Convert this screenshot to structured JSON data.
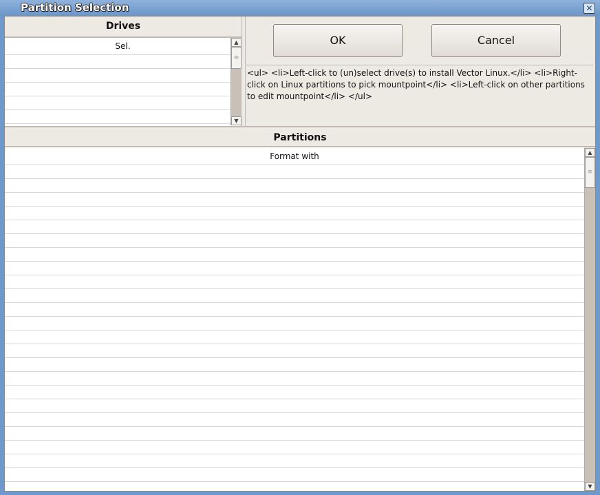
{
  "window": {
    "title": "Partition Selection",
    "close_icon": "close-icon"
  },
  "drives": {
    "header": "Drives",
    "columns": [
      "Sel."
    ],
    "rows": []
  },
  "buttons": {
    "ok": "OK",
    "cancel": "Cancel"
  },
  "info_text": "<ul> <li>Left-click to (un)select drive(s) to install Vector Linux.</li> <li>Right-click on Linux partitions to pick mountpoint</li> <li>Left-click on other partitions to edit mountpoint</li> </ul>",
  "partitions": {
    "header": "Partitions",
    "columns": [
      "Format with"
    ],
    "rows": []
  }
}
